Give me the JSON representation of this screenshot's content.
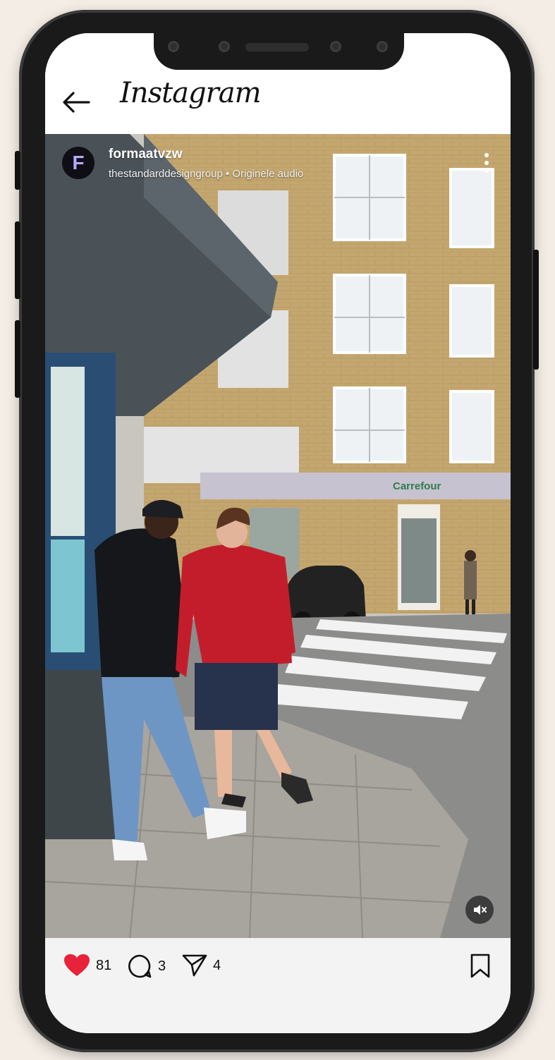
{
  "app": {
    "title": "Instagram"
  },
  "post": {
    "username": "formaatvzw",
    "avatar_letter": "F",
    "subline": "thestandarddesigngroup • Originele audio",
    "store_sign": "Carrefour"
  },
  "actions": {
    "likes": "81",
    "comments": "3",
    "shares": "4"
  },
  "colors": {
    "like": "#e8223a",
    "background": "#f4ede6",
    "phone": "#1a1a1a"
  },
  "icons": [
    "back-arrow-icon",
    "more-icon",
    "mute-icon",
    "heart-icon",
    "comment-icon",
    "share-icon",
    "bookmark-icon"
  ]
}
